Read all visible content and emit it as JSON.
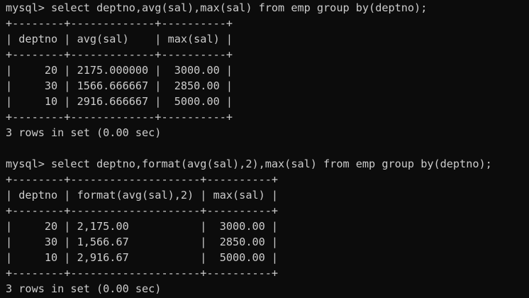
{
  "colors": {
    "background": "#0c0c0c",
    "text": "#cccccc"
  },
  "terminal": {
    "query1": {
      "command": "mysql> select deptno,avg(sal),max(sal) from emp group by(deptno);",
      "lines": [
        "+--------+-------------+----------+",
        "| deptno | avg(sal)    | max(sal) |",
        "+--------+-------------+----------+",
        "|     20 | 2175.000000 |  3000.00 |",
        "|     30 | 1566.666667 |  2850.00 |",
        "|     10 | 2916.666667 |  5000.00 |",
        "+--------+-------------+----------+"
      ],
      "status": "3 rows in set (0.00 sec)"
    },
    "query2": {
      "command": "mysql> select deptno,format(avg(sal),2),max(sal) from emp group by(deptno);",
      "lines": [
        "+--------+--------------------+----------+",
        "| deptno | format(avg(sal),2) | max(sal) |",
        "+--------+--------------------+----------+",
        "|     20 | 2,175.00           |  3000.00 |",
        "|     30 | 1,566.67           |  2850.00 |",
        "|     10 | 2,916.67           |  5000.00 |",
        "+--------+--------------------+----------+"
      ],
      "status": "3 rows in set (0.00 sec)"
    }
  }
}
